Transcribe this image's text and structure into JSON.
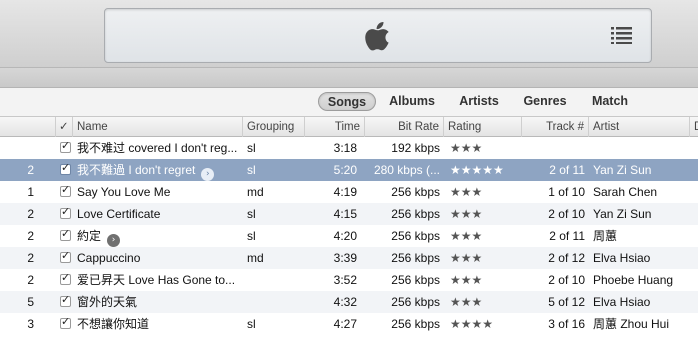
{
  "toolbar": {
    "logo_icon": "apple-logo-icon",
    "list_view_icon": "list-icon"
  },
  "view_tabs": [
    {
      "label": "Songs",
      "active": true
    },
    {
      "label": "Albums",
      "active": false
    },
    {
      "label": "Artists",
      "active": false
    },
    {
      "label": "Genres",
      "active": false
    },
    {
      "label": "Match",
      "active": false
    }
  ],
  "columns": {
    "check": "✓",
    "name": "Name",
    "grouping": "Grouping",
    "time": "Time",
    "bitrate": "Bit Rate",
    "rating": "Rating",
    "track": "Track #",
    "artist": "Artist",
    "extra": "D"
  },
  "rows": [
    {
      "num": "",
      "name": "我不难过 covered I don't reg...",
      "arrow": false,
      "grouping": "sl",
      "time": "3:18",
      "bitrate": "192 kbps",
      "rating": 3,
      "track": "",
      "artist": "",
      "selected": false
    },
    {
      "num": "2",
      "name": "我不難過 I don't regret",
      "arrow": true,
      "grouping": "sl",
      "time": "5:20",
      "bitrate": "280 kbps (...",
      "rating": 5,
      "track": "2 of 11",
      "artist": "Yan Zi Sun",
      "selected": true
    },
    {
      "num": "1",
      "name": "Say You Love Me",
      "arrow": false,
      "grouping": "md",
      "time": "4:19",
      "bitrate": "256 kbps",
      "rating": 3,
      "track": "1 of 10",
      "artist": "Sarah Chen",
      "selected": false
    },
    {
      "num": "2",
      "name": "Love Certificate",
      "arrow": false,
      "grouping": "sl",
      "time": "4:15",
      "bitrate": "256 kbps",
      "rating": 3,
      "track": "2 of 10",
      "artist": "Yan Zi Sun",
      "selected": false
    },
    {
      "num": "2",
      "name": "約定",
      "arrow": true,
      "grouping": "sl",
      "time": "4:20",
      "bitrate": "256 kbps",
      "rating": 3,
      "track": "2 of 11",
      "artist": "周蕙",
      "selected": false
    },
    {
      "num": "2",
      "name": "Cappuccino",
      "arrow": false,
      "grouping": "md",
      "time": "3:39",
      "bitrate": "256 kbps",
      "rating": 3,
      "track": "2 of 12",
      "artist": "Elva Hsiao",
      "selected": false
    },
    {
      "num": "2",
      "name": "爱已昇天 Love Has Gone to...",
      "arrow": false,
      "grouping": "",
      "time": "3:52",
      "bitrate": "256 kbps",
      "rating": 3,
      "track": "2 of 10",
      "artist": "Phoebe Huang",
      "selected": false
    },
    {
      "num": "5",
      "name": "窗外的天氣",
      "arrow": false,
      "grouping": "",
      "time": "4:32",
      "bitrate": "256 kbps",
      "rating": 3,
      "track": "5 of 12",
      "artist": "Elva Hsiao",
      "selected": false
    },
    {
      "num": "3",
      "name": "不想讓你知道",
      "arrow": false,
      "grouping": "sl",
      "time": "4:27",
      "bitrate": "256 kbps",
      "rating": 4,
      "track": "3 of 16",
      "artist": "周蕙 Zhou Hui",
      "selected": false
    }
  ]
}
